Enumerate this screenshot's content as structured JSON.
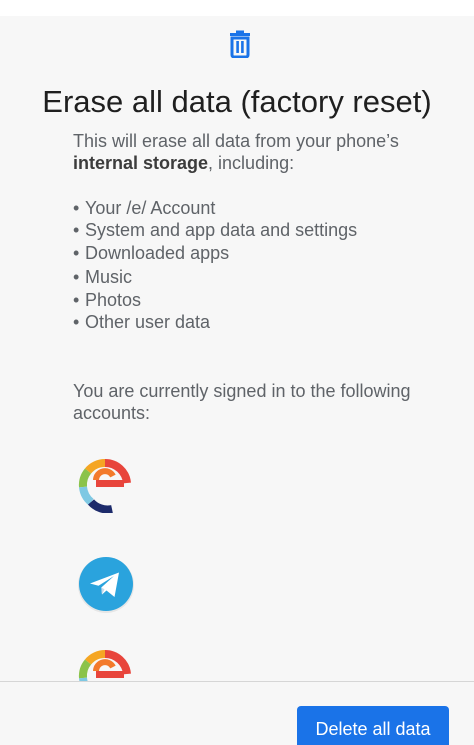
{
  "header": {
    "icon": "trash-icon",
    "title": "Erase all data (factory reset)"
  },
  "intro": {
    "text_before": "This will erase all data from your phone’s ",
    "bold": "internal storage",
    "text_after": ", including:"
  },
  "items": [
    {
      "label": "Your /e/ Account"
    },
    {
      "label": "System and app data and settings"
    },
    {
      "label": "Downloaded apps"
    },
    {
      "label": "Music"
    },
    {
      "label": "Photos"
    },
    {
      "label": "Other user data"
    }
  ],
  "bullet_char": "•",
  "accounts": {
    "heading": "You are currently signed in to the following accounts:",
    "list": [
      {
        "icon": "e-account-icon",
        "label": ""
      },
      {
        "icon": "telegram-icon",
        "label": ""
      },
      {
        "icon": "e-account-icon",
        "label": ""
      }
    ]
  },
  "footer": {
    "delete_label": "Delete all data"
  },
  "colors": {
    "accent": "#1a73e8",
    "telegram": "#2aa3dd",
    "text_secondary": "#5f6368"
  }
}
